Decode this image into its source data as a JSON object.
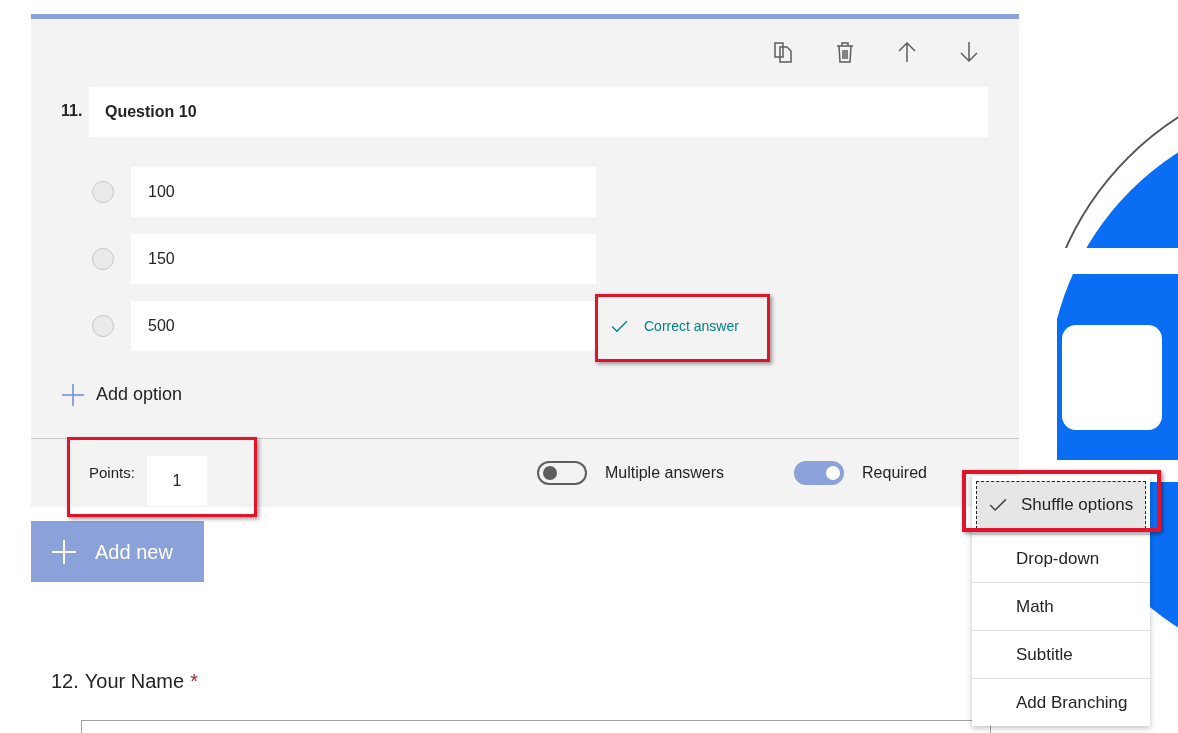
{
  "question": {
    "number": "11.",
    "title": "Question 10",
    "options": [
      {
        "text": "100",
        "correct": false,
        "selected": false
      },
      {
        "text": "150",
        "correct": false,
        "selected": false
      },
      {
        "text": "500",
        "correct": true,
        "selected": false
      }
    ],
    "correct_label": "Correct answer",
    "add_option": "Add option",
    "points_label": "Points:",
    "points": "1",
    "toggles": [
      {
        "label": "Multiple answers",
        "on": false
      },
      {
        "label": "Required",
        "on": true
      }
    ]
  },
  "add_new": "Add new",
  "next_question": {
    "number": "12.",
    "title": "Your Name",
    "required_mark": "*"
  },
  "menu": [
    {
      "label": "Shuffle options",
      "checked": true
    },
    {
      "label": "Drop-down",
      "checked": false
    },
    {
      "label": "Math",
      "checked": false
    },
    {
      "label": "Subtitle",
      "checked": false
    },
    {
      "label": "Add Branching",
      "checked": false
    }
  ]
}
